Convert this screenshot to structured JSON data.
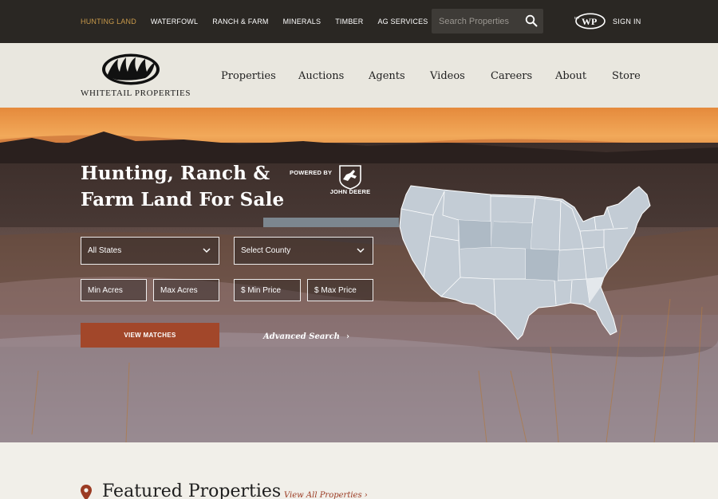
{
  "topbar": {
    "nav": [
      "HUNTING LAND",
      "WATERFOWL",
      "RANCH & FARM",
      "MINERALS",
      "TIMBER",
      "AG SERVICES"
    ],
    "active_index": 0,
    "search_placeholder": "Search Properties",
    "search_icon": "search-icon",
    "account_logo": "mywp-logo",
    "signin_label": "SIGN IN",
    "background": "#2a2723",
    "active_color": "#c99a4b"
  },
  "header": {
    "logo_text": "WHITETAIL PROPERTIES",
    "nav": [
      "Properties",
      "Auctions",
      "Agents",
      "Videos",
      "Careers",
      "About",
      "Store"
    ],
    "background": "#e9e7df"
  },
  "hero": {
    "title_line1": "Hunting, Ranch &",
    "title_line2": "Farm Land For Sale",
    "powered_by": "POWERED BY",
    "sponsor": "JOHN DEERE",
    "state_select": "All States",
    "county_select": "Select County",
    "min_acres": "Min Acres",
    "max_acres": "Max Acres",
    "min_price": "$ Min Price",
    "max_price": "$ Max Price",
    "view_matches": "VIEW MATCHES",
    "advanced_search": "Advanced Search",
    "map_icon": "us-map",
    "button_color": "#a2472a"
  },
  "featured": {
    "title": "Featured Properties",
    "view_all": "View All Properties",
    "pin_icon": "map-pin-icon",
    "accent": "#9b3b23"
  }
}
